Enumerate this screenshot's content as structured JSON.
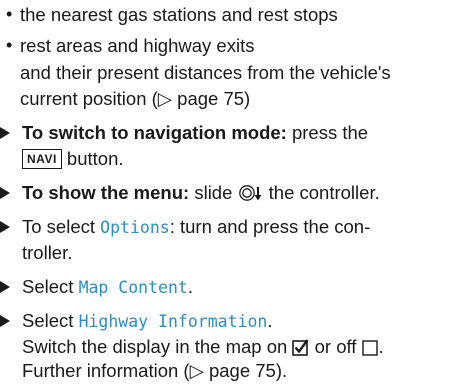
{
  "items": {
    "b1": "the nearest gas stations and rest stops",
    "b2": "rest areas and highway exits",
    "b2_cont1": "and their present distances from the vehicle's",
    "b2_cont2": "current position (▷ page 75)",
    "s1_bold": "To switch to navigation mode:",
    "s1_rest": " press the",
    "s1_key": "NAVI",
    "s1_end": " button.",
    "s2_bold": "To show the menu:",
    "s2_mid": " slide ",
    "s2_end": " the controller.",
    "s3_pre": "To select ",
    "s3_mono": "Options",
    "s3_post": ": turn and press the con-",
    "s3_cont": "troller.",
    "s4_pre": "Select ",
    "s4_mono": "Map Content",
    "s4_post": ".",
    "s5_pre": "Select ",
    "s5_mono": "Highway Information",
    "s5_post": ".",
    "s5_c1_a": "Switch the display in the map on ",
    "s5_c1_b": " or off ",
    "s5_c1_c": ".",
    "s5_c2": "Further information (▷ page 75)."
  },
  "icons": {
    "controller": "controller-slide-down-icon",
    "checked": "checkbox-checked-icon",
    "unchecked": "checkbox-unchecked-icon"
  },
  "colors": {
    "code_text": "#2a8fbf",
    "text": "#1a1a1a"
  }
}
